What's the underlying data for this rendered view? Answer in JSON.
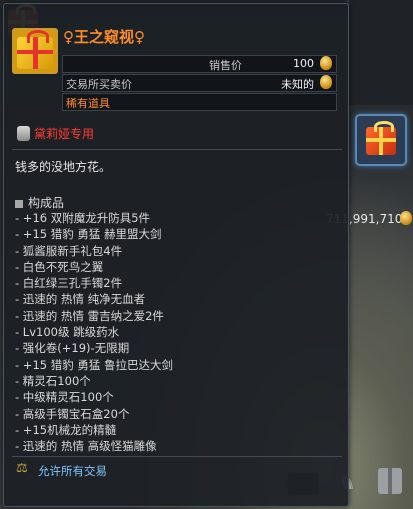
{
  "background": {
    "money": "711,991,710",
    "money_icon": "coin-bag-icon",
    "slot_icon": "gift-box-icon"
  },
  "item": {
    "icon": "gift-box-icon",
    "title": "♀王之窥视♀",
    "sell_price_label": "销售价",
    "sell_price_value": "100",
    "market_price_label": "交易所买卖价",
    "market_price_value": "未知的",
    "grade": "稀有道具",
    "restriction": "黛莉娅专用",
    "description": "钱多的没地方花。",
    "components_header": "构成品",
    "components": [
      "- +16 双附魔龙升防具5件",
      "- +15 猎豹 勇猛 赫里盟大剑",
      "- 狐酱服新手礼包4件",
      "- 白色不死鸟之翼",
      "- 白红绿三孔手镯2件",
      "- 迅速的 热情 纯净无血者",
      "- 迅速的 热情 雷吉纳之爱2件",
      "- Lv100级 跳级药水",
      "- 强化卷(+19)-无限期",
      "- +15 猎豹 勇猛 鲁拉巴达大剑",
      "- 精灵石100个",
      "- 中级精灵石100个",
      "- 高级手镯宝石盒20个",
      "- +15机械龙的精髓",
      "- 迅速的 热情 高级怪猫雕像"
    ],
    "trade_info": "允许所有交易",
    "colors": {
      "title": "#ff8c2a",
      "restriction": "#ff3b2f",
      "trade": "#7fc6ff"
    }
  }
}
